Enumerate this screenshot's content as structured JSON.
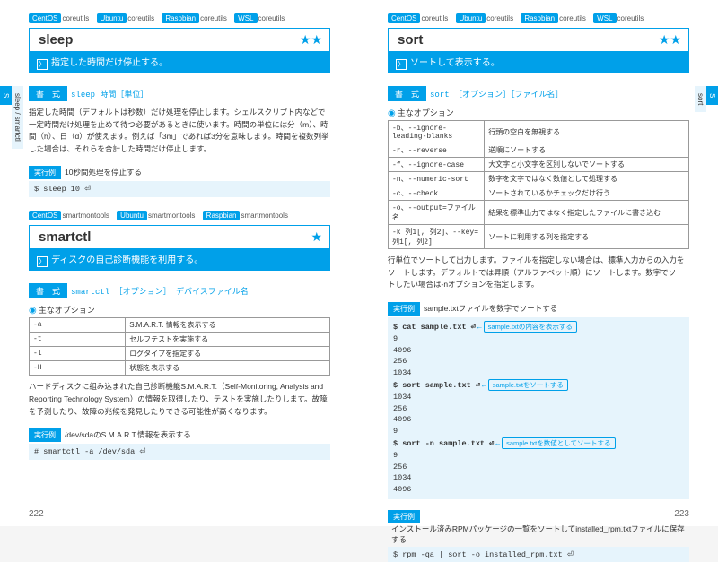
{
  "leftTab1": "S",
  "leftTab2": "sleep / smartctl",
  "rightTab1": "S",
  "rightTab2": "sort",
  "page_left_num": "222",
  "page_right_num": "223",
  "left": {
    "tags": {
      "os1": "CentOS",
      "pk1": "coreutils",
      "os2": "Ubuntu",
      "pk2": "coreutils",
      "os3": "Raspbian",
      "pk3": "coreutils",
      "os4": "WSL",
      "pk4": "coreutils"
    },
    "sleep": {
      "name": "sleep",
      "stars": "★★",
      "desc": "指定した時間だけ停止する。",
      "syntax_lbl": "書　式",
      "syntax": "sleep 時間［単位］",
      "body": "指定した時間（デフォルトは秒数）だけ処理を停止します。シェルスクリプト内などで一定時間だけ処理を止めて待つ必要があるときに使います。時間の単位には分（m）、時間（h）、日（d）が使えます。例えば「3m」であれば3分を意味します。時間を複数列挙した場合は、それらを合計した時間だけ停止します。",
      "exec_lbl": "実行例",
      "exec_desc": "10秒間処理を停止する",
      "exec_cmd": "$ sleep 10 ⏎"
    },
    "tags2": {
      "os1": "CentOS",
      "pk1": "smartmontools",
      "os2": "Ubuntu",
      "pk2": "smartmontools",
      "os3": "Raspbian",
      "pk3": "smartmontools"
    },
    "smartctl": {
      "name": "smartctl",
      "stars": "★",
      "desc": "ディスクの自己診断機能を利用する。",
      "syntax_lbl": "書　式",
      "syntax": "smartctl ［オプション］ デバイスファイル名",
      "opt_lbl": "主なオプション",
      "opts": [
        {
          "o": "-a",
          "d": "S.M.A.R.T. 情報を表示する"
        },
        {
          "o": "-t",
          "d": "セルフテストを実施する"
        },
        {
          "o": "-l",
          "d": "ログタイプを指定する"
        },
        {
          "o": "-H",
          "d": "状態を表示する"
        }
      ],
      "body": "ハードディスクに組み込まれた自己診断機能S.M.A.R.T.（Self-Monitoring, Analysis and Reporting Technology System）の情報を取得したり、テストを実施したりします。故障を予測したり、故障の兆候を発見したりできる可能性が高くなります。",
      "exec_lbl": "実行例",
      "exec_desc": "/dev/sdaのS.M.A.R.T.情報を表示する",
      "exec_cmd": "# smartctl -a /dev/sda ⏎"
    }
  },
  "right": {
    "tags": {
      "os1": "CentOS",
      "pk1": "coreutils",
      "os2": "Ubuntu",
      "pk2": "coreutils",
      "os3": "Raspbian",
      "pk3": "coreutils",
      "os4": "WSL",
      "pk4": "coreutils"
    },
    "sort": {
      "name": "sort",
      "stars": "★★",
      "desc": "ソートして表示する。",
      "syntax_lbl": "書　式",
      "syntax": "sort ［オプション］［ファイル名］",
      "opt_lbl": "主なオプション",
      "opts": [
        {
          "o": "-b、--ignore-leading-blanks",
          "d": "行頭の空白を無視する"
        },
        {
          "o": "-r、--reverse",
          "d": "逆順にソートする"
        },
        {
          "o": "-f、--ignore-case",
          "d": "大文字と小文字を区別しないでソートする"
        },
        {
          "o": "-n、--numeric-sort",
          "d": "数字を文字ではなく数値として処理する"
        },
        {
          "o": "-c、--check",
          "d": "ソートされているかチェックだけ行う"
        },
        {
          "o": "-o、--output=ファイル名",
          "d": "結果を標準出力ではなく指定したファイルに書き込む"
        },
        {
          "o": "-k 列1[, 列2]、--key=列1[, 列2]",
          "d": "ソートに利用する列を指定する"
        }
      ],
      "body": "行単位でソートして出力します。ファイルを指定しない場合は、標準入力からの入力をソートします。デフォルトでは昇順（アルファベット順）にソートします。数字でソートしたい場合は-nオプションを指定します。",
      "exec_lbl": "実行例",
      "exec_desc": "sample.txtファイルを数字でソートする",
      "t1": {
        "cmd": "$ cat sample.txt ⏎",
        "note": "sample.txtの内容を表示する",
        "o": [
          "9",
          "4096",
          "256",
          "1034"
        ]
      },
      "t2": {
        "cmd": "$ sort sample.txt ⏎",
        "note": "sample.txtをソートする",
        "o": [
          "1034",
          "256",
          "4096",
          "9"
        ]
      },
      "t3": {
        "cmd": "$ sort -n sample.txt ⏎",
        "note": "sample.txtを数値としてソートする",
        "o": [
          "9",
          "256",
          "1034",
          "4096"
        ]
      },
      "exec2_lbl": "実行例",
      "exec2_desc": "インストール済みRPMパッケージの一覧をソートしてinstalled_rpm.txtファイルに保存する",
      "exec2_cmd": "$ rpm -qa | sort -o installed_rpm.txt ⏎"
    }
  }
}
